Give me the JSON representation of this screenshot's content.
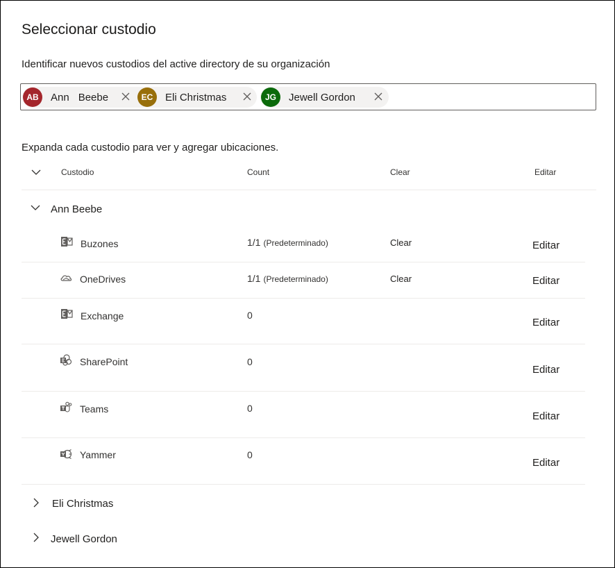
{
  "title": "Seleccionar custodio",
  "subtitle": "Identificar nuevos custodios del active directory de su organización",
  "chips": [
    {
      "initials": "AB",
      "first": "Ann",
      "last": "Beebe",
      "color": "#a4262c"
    },
    {
      "initials": "EC",
      "name": "Eli Christmas",
      "color": "#986f0b"
    },
    {
      "initials": "JG",
      "name": "Jewell Gordon",
      "color": "#0b6a0b"
    }
  ],
  "instructions": "Expanda cada custodio para ver y agregar ubicaciones.",
  "table": {
    "headers": {
      "custodian": "Custodio",
      "count": "Count",
      "clear": "Clear",
      "edit": "Editar"
    }
  },
  "custodians": [
    {
      "name": "Ann Beebe",
      "expanded": true,
      "locations": [
        {
          "label": "Buzones",
          "icon": "exchange-mailbox-icon",
          "count": "1/1",
          "count_note": "(Predeterminado)",
          "clear": "Clear",
          "edit": "Editar"
        },
        {
          "label": "OneDrives",
          "icon": "onedrive-cloud-icon",
          "count": "1/1",
          "count_note": "(Predeterminado)",
          "clear": "Clear",
          "edit": "Editar"
        },
        {
          "label": "Exchange",
          "icon": "exchange-icon",
          "count": "0",
          "edit": "Editar"
        },
        {
          "label": "SharePoint",
          "icon": "sharepoint-icon",
          "count": "0",
          "edit": "Editar"
        },
        {
          "label": "Teams",
          "icon": "teams-icon",
          "count": "0",
          "edit": "Editar"
        },
        {
          "label": "Yammer",
          "icon": "yammer-icon",
          "count": "0",
          "edit": "Editar"
        }
      ]
    },
    {
      "name": "Eli Christmas",
      "expanded": false
    },
    {
      "name": "Jewell Gordon",
      "expanded": false
    }
  ]
}
